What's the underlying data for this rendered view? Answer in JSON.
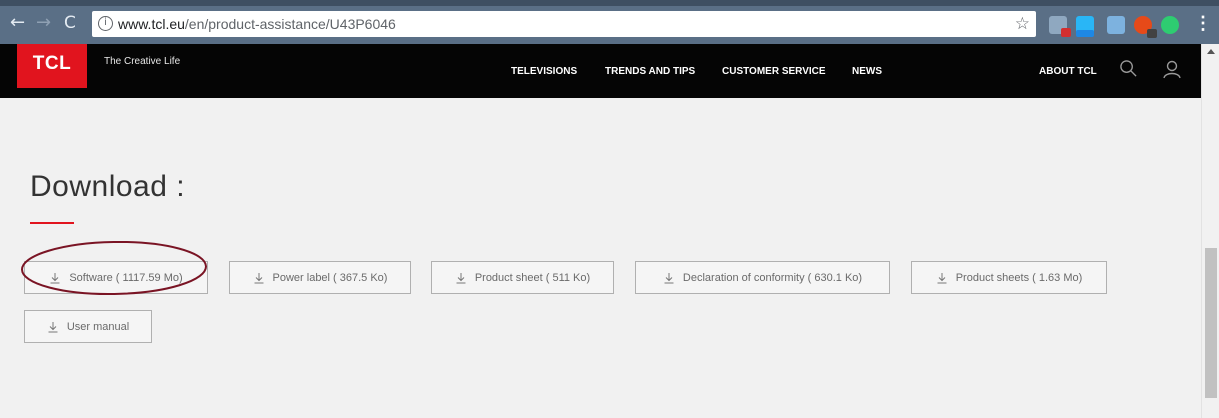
{
  "browser": {
    "url_host": "www.tcl.eu",
    "url_path": "/en/product-assistance/U43P6046",
    "nav": {
      "back": "←",
      "forward": "→",
      "reload": "C"
    },
    "info_glyph": "i",
    "star_glyph": "☆",
    "menu_glyph": "⋮",
    "extensions": [
      "extension-icon",
      "stylus-extension-icon",
      "extension-icon",
      "opera-extension-icon",
      "grammarly-extension-icon"
    ]
  },
  "header": {
    "logo": "TCL",
    "tagline": "The Creative Life",
    "nav": [
      "TELEVISIONS",
      "TRENDS AND TIPS",
      "CUSTOMER SERVICE",
      "NEWS"
    ],
    "about": "ABOUT TCL",
    "colors": {
      "brand_red": "#e1141e",
      "header_bg": "#050505"
    }
  },
  "main": {
    "title": "Download :",
    "downloads": [
      {
        "label": "Software ( 1117.59 Mo)"
      },
      {
        "label": "Power label ( 367.5 Ko)"
      },
      {
        "label": "Product sheet ( 511 Ko)"
      },
      {
        "label": "Declaration of conformity ( 630.1 Ko)"
      },
      {
        "label": "Product sheets ( 1.63 Mo)"
      },
      {
        "label": "User manual"
      }
    ],
    "annotation_color": "#7a1424"
  }
}
